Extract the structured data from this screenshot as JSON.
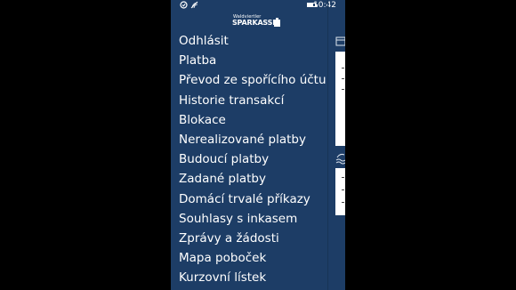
{
  "status_bar": {
    "time": "10:42",
    "battery_level": 0.7,
    "icons": [
      "notification-icon",
      "signal-icon",
      "battery-icon"
    ]
  },
  "logo": {
    "small_text": "Waldviertler",
    "big_text": "SPARKASSE"
  },
  "menu": {
    "items": [
      "Odhlásit",
      "Platba",
      "Převod ze spořícího účtu",
      "Historie transakcí",
      "Blokace",
      "Nerealizované platby",
      "Budoucí platby",
      "Zadané platby",
      "Domácí trvalé příkazy",
      "Souhlasy s inkasem",
      "Zprávy a žádosti",
      "Mapa poboček",
      "Kurzovní lístek"
    ]
  },
  "colors": {
    "page_background": "#000000",
    "menu_background": "#1d3d66",
    "text": "#ffffff"
  }
}
